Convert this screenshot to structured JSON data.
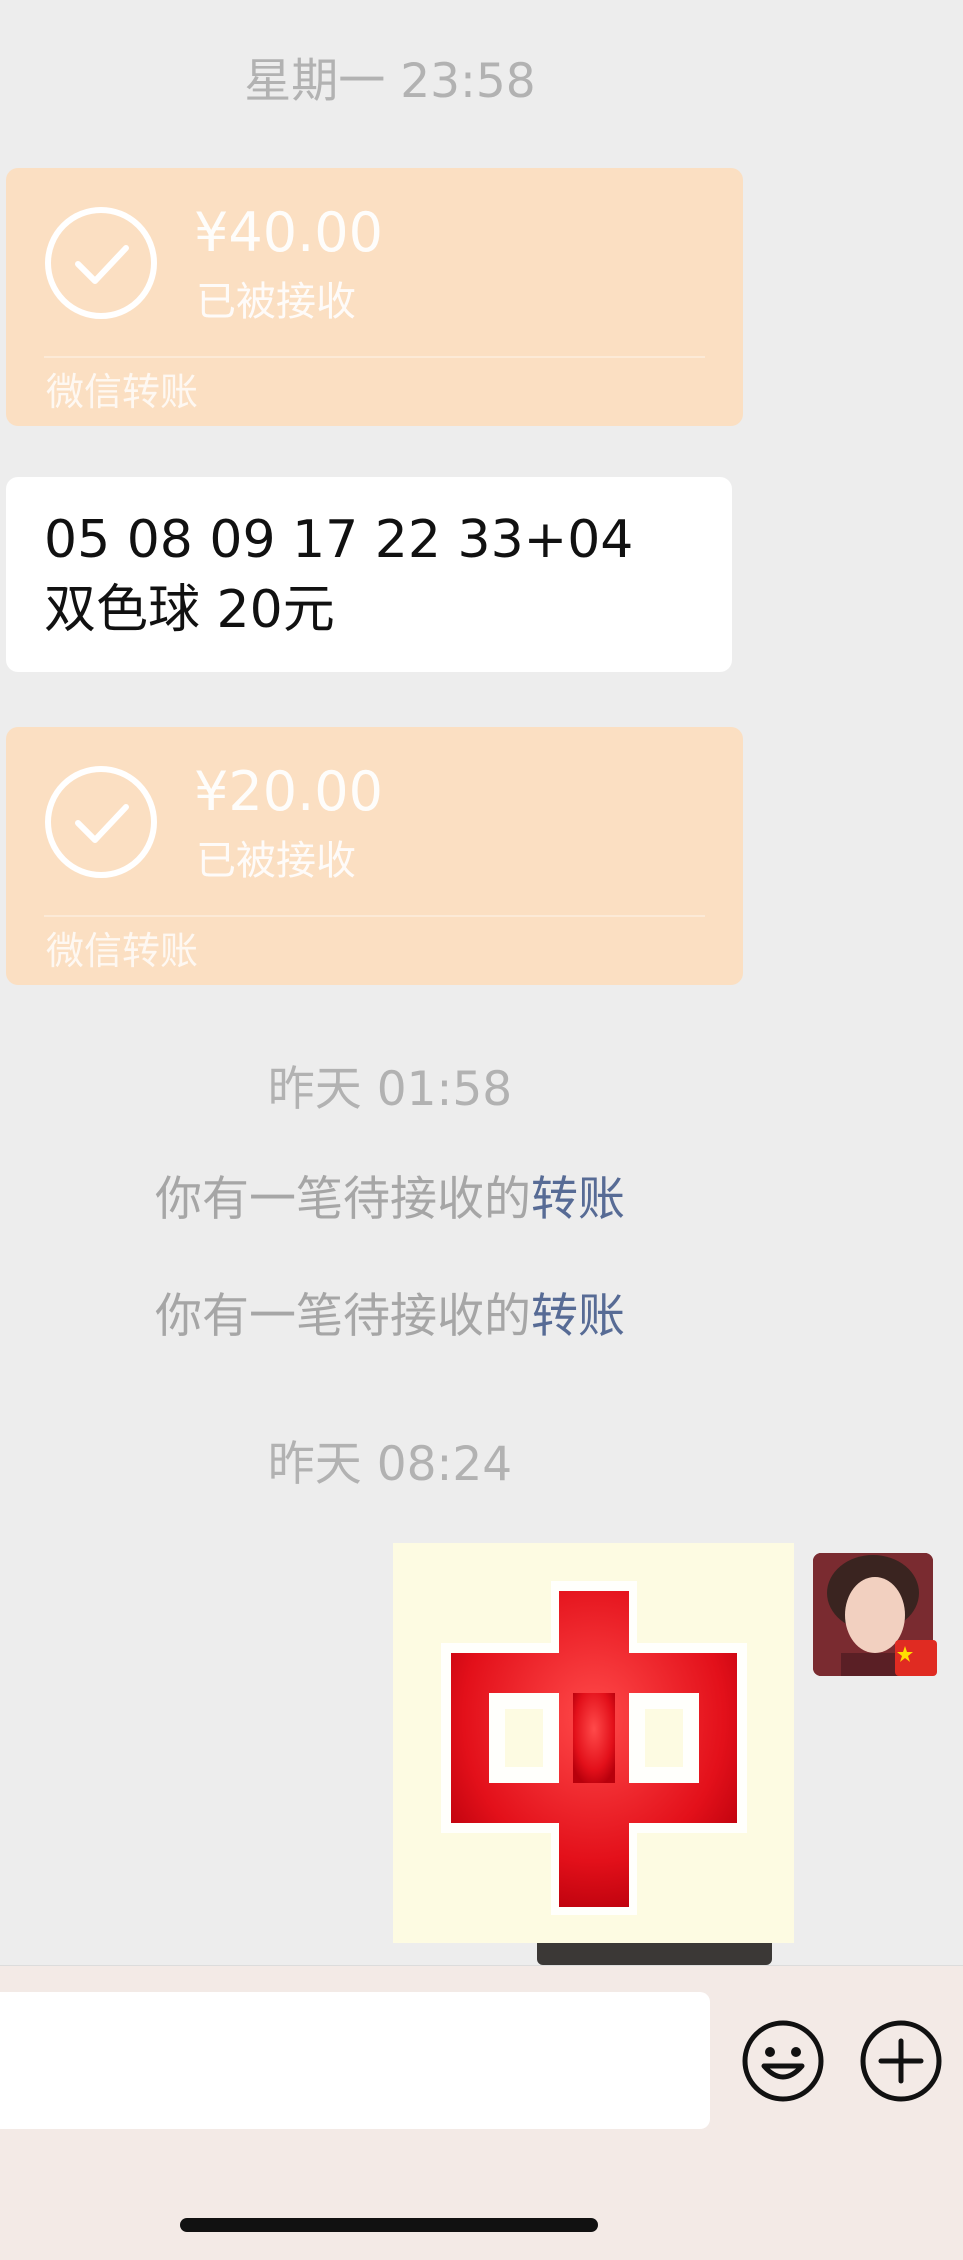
{
  "messages": {
    "timestamp_1": "星期一 23:58",
    "transfer_1": {
      "amount": "¥40.00",
      "status": "已被接收",
      "brand": "微信转账"
    },
    "text_1": "05 08 09 17 22 33+04 双色球 20元",
    "transfer_2": {
      "amount": "¥20.00",
      "status": "已被接收",
      "brand": "微信转账"
    },
    "timestamp_2": "昨天 01:58",
    "system_1": {
      "text": "你有一笔待接收的",
      "link": "转账"
    },
    "system_2": {
      "text": "你有一笔待接收的",
      "link": "转账"
    },
    "timestamp_3": "昨天 08:24",
    "sticker": {
      "glyph": "中",
      "color": "#e3101a"
    }
  },
  "input_bar": {
    "emoji_icon": "smiley-face-icon",
    "more_icon": "plus-circle-icon"
  },
  "colors": {
    "background": "#ededed",
    "transfer_card": "#fbdfc2",
    "link": "#576b95",
    "timestamp": "#b2b2b2"
  }
}
